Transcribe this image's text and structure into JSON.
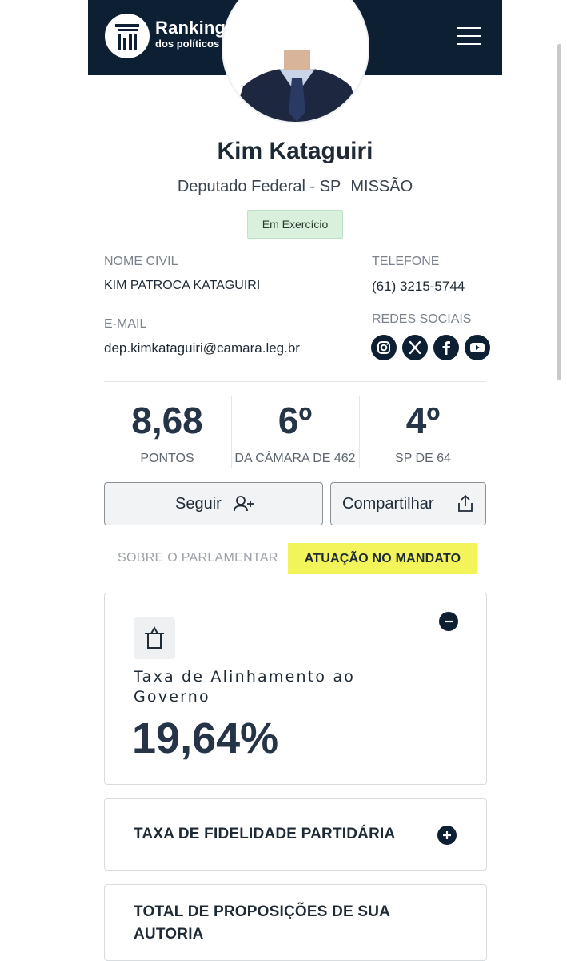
{
  "header": {
    "logo_title": "Ranking",
    "logo_subtitle": "dos políticos",
    "logo_icon": "columns-logo-icon",
    "menu_icon": "hamburger-menu-icon"
  },
  "profile": {
    "name": "Kim Kataguiri",
    "role": "Deputado Federal - SP",
    "party": "MISSÃO",
    "status": "Em Exercício"
  },
  "info": {
    "civil_name_label": "NOME CIVIL",
    "civil_name": "KIM PATROCA KATAGUIRI",
    "phone_label": "TELEFONE",
    "phone": "(61) 3215-5744",
    "email_label": "E-MAIL",
    "email": "dep.kimkataguiri@camara.leg.br",
    "social_label": "REDES SOCIAIS",
    "social_icons": [
      "instagram-icon",
      "x-icon",
      "facebook-icon",
      "youtube-icon"
    ]
  },
  "stats": [
    {
      "value": "8,68",
      "label": "PONTOS"
    },
    {
      "value": "6º",
      "label": "DA CÂMARA DE 462"
    },
    {
      "value": "4º",
      "label": "SP DE 64"
    }
  ],
  "actions": {
    "follow_label": "Seguir",
    "share_label": "Compartilhar"
  },
  "tabs": {
    "about": "SOBRE O PARLAMENTAR",
    "mandate": "ATUAÇÃO NO MANDATO",
    "active": "mandate"
  },
  "metrics": {
    "alignment_title": "Taxa de Alinhamento ao Governo",
    "alignment_value": "19,64%",
    "fidelity_title": "TAXA DE FIDELIDADE PARTIDÁRIA",
    "propositions_title": "TOTAL DE PROPOSIÇÕES DE SUA AUTORIA"
  },
  "colors": {
    "header_bg": "#0d1f33",
    "status_bg": "#d8f0dc",
    "active_tab_bg": "#f2f45a",
    "chat_button": "#2a3441"
  }
}
